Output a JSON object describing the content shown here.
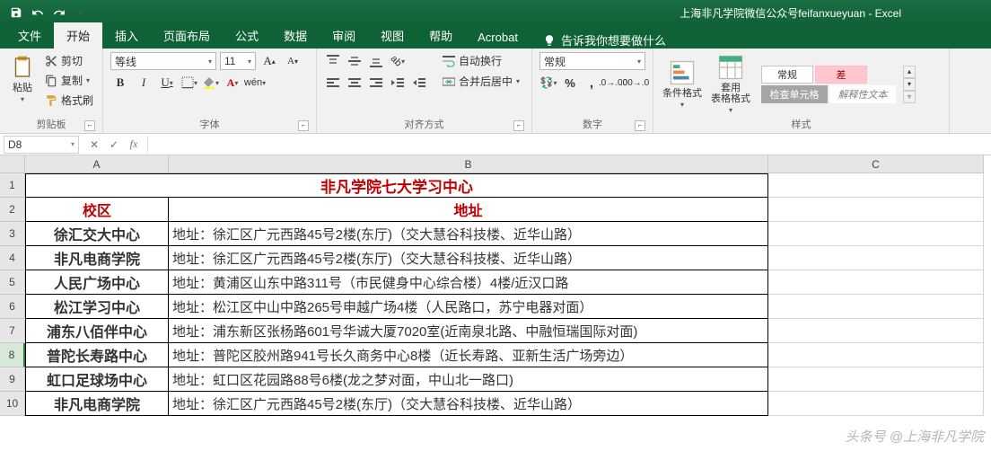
{
  "app": {
    "title": "上海非凡学院微信公众号feifanxueyuan - Excel"
  },
  "tabs": {
    "file": "文件",
    "home": "开始",
    "insert": "插入",
    "layout": "页面布局",
    "formulas": "公式",
    "data": "数据",
    "review": "审阅",
    "view": "视图",
    "help": "帮助",
    "acrobat": "Acrobat",
    "tell": "告诉我你想要做什么"
  },
  "ribbon": {
    "clipboard": {
      "label": "剪贴板",
      "paste": "粘贴",
      "cut": "剪切",
      "copy": "复制",
      "painter": "格式刷"
    },
    "font": {
      "label": "字体",
      "name": "等线",
      "size": "11",
      "wen": "wén"
    },
    "align": {
      "label": "对齐方式",
      "wrap": "自动换行",
      "merge": "合并后居中"
    },
    "number": {
      "label": "数字",
      "format": "常规"
    },
    "styles": {
      "label": "样式",
      "cond": "条件格式",
      "table": "套用\n表格格式",
      "normal": "常规",
      "bad": "差",
      "check": "检查单元格",
      "explain": "解释性文本"
    }
  },
  "formula_bar": {
    "cell_ref": "D8"
  },
  "columns": [
    "A",
    "B",
    "C"
  ],
  "rows": [
    "1",
    "2",
    "3",
    "4",
    "5",
    "6",
    "7",
    "8",
    "9",
    "10"
  ],
  "sheet": {
    "title": "非凡学院七大学习中心",
    "h_campus": "校区",
    "h_addr": "地址",
    "data": [
      {
        "campus": "徐汇交大中心",
        "addr": "地址：徐汇区广元西路45号2楼(东厅)（交大慧谷科技楼、近华山路）"
      },
      {
        "campus": "非凡电商学院",
        "addr": "地址：徐汇区广元西路45号2楼(东厅)（交大慧谷科技楼、近华山路）"
      },
      {
        "campus": "人民广场中心",
        "addr": "地址：黄浦区山东中路311号（市民健身中心综合楼）4楼/近汉口路"
      },
      {
        "campus": "松江学习中心",
        "addr": "地址：松江区中山中路265号申越广场4楼（人民路口，苏宁电器对面）"
      },
      {
        "campus": "浦东八佰伴中心",
        "addr": "地址：浦东新区张杨路601号华诚大厦7020室(近南泉北路、中融恒瑞国际对面)"
      },
      {
        "campus": "普陀长寿路中心",
        "addr": "地址：普陀区胶州路941号长久商务中心8楼（近长寿路、亚新生活广场旁边）"
      },
      {
        "campus": "虹口足球场中心",
        "addr": "地址：虹口区花园路88号6楼(龙之梦对面，中山北一路口)"
      },
      {
        "campus": "非凡电商学院",
        "addr": "地址：徐汇区广元西路45号2楼(东厅)（交大慧谷科技楼、近华山路）"
      }
    ]
  },
  "watermark": "头条号 @上海非凡学院"
}
